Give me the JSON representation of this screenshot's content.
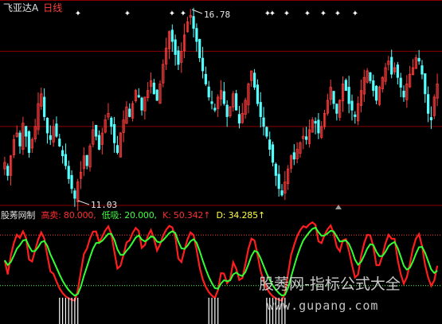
{
  "header": {
    "stock_name": "飞亚达A",
    "period": "日线"
  },
  "price_chart": {
    "high_label": "16.78",
    "low_label": "11.03",
    "high_value": 16.78,
    "low_value": 11.03
  },
  "indicator": {
    "name": "股莠网制",
    "sell_label": "高卖: 80.000,",
    "buy_label": "低吸: 20.000,",
    "k_label": "K: 50.342↑",
    "d_label": "D: 34.285↑",
    "colors": {
      "name": "#e0e0e0",
      "sell": "#ff3030",
      "buy": "#40ff40",
      "k": "#ff3030",
      "d": "#ffff40"
    }
  },
  "watermark": {
    "line1": "股莠网-指标公式大全",
    "line2": "www.gupang.com"
  },
  "colors": {
    "up": "#ff3c3c",
    "down": "#54ffff",
    "grid": "#8b0000",
    "k_line": "#ff1e1e",
    "d_line": "#32ff32"
  },
  "chart_data": {
    "type": "candlestick",
    "ylim": [
      11.03,
      16.78
    ],
    "closes": [
      12.2,
      11.8,
      12.4,
      12.9,
      13.1,
      12.7,
      13.4,
      13.0,
      12.5,
      12.9,
      13.3,
      14.0,
      14.3,
      13.6,
      13.1,
      12.9,
      13.3,
      13.0,
      12.7,
      12.4,
      12.1,
      11.7,
      11.4,
      11.1,
      11.6,
      11.9,
      12.4,
      12.1,
      12.7,
      13.2,
      13.0,
      12.6,
      13.1,
      13.5,
      13.7,
      13.3,
      12.8,
      12.5,
      13.1,
      13.5,
      13.9,
      13.6,
      14.0,
      14.4,
      14.2,
      13.8,
      14.2,
      14.4,
      14.7,
      14.3,
      14.1,
      14.6,
      15.2,
      15.7,
      16.2,
      15.9,
      15.5,
      15.2,
      15.6,
      16.1,
      16.5,
      16.7,
      16.3,
      15.9,
      15.4,
      15.0,
      14.6,
      14.2,
      14.0,
      13.8,
      14.2,
      14.4,
      14.0,
      13.6,
      13.9,
      14.3,
      13.8,
      13.4,
      13.7,
      14.1,
      14.6,
      15.0,
      14.5,
      14.0,
      13.6,
      13.3,
      13.0,
      12.6,
      12.2,
      11.8,
      11.4,
      11.2,
      11.6,
      12.0,
      12.4,
      12.3,
      12.6,
      12.8,
      13.0,
      12.9,
      13.2,
      13.5,
      13.4,
      13.1,
      13.3,
      13.7,
      14.1,
      14.5,
      14.0,
      13.7,
      14.1,
      14.6,
      14.4,
      14.0,
      13.8,
      13.6,
      14.0,
      14.4,
      14.8,
      15.0,
      14.7,
      14.4,
      14.1,
      14.5,
      14.8,
      15.1,
      15.3,
      14.9,
      15.1,
      14.8,
      14.5,
      14.2,
      14.6,
      14.9,
      15.1,
      15.4,
      15.3,
      14.9,
      14.3,
      13.7,
      13.5,
      14.2,
      14.6
    ],
    "ref_levels": [
      15.6,
      13.3
    ],
    "indicator": {
      "ylim": [
        0,
        100
      ],
      "levels": {
        "sell": 80,
        "buy": 20
      },
      "k_last": 50.342,
      "d_last": 34.285
    }
  }
}
